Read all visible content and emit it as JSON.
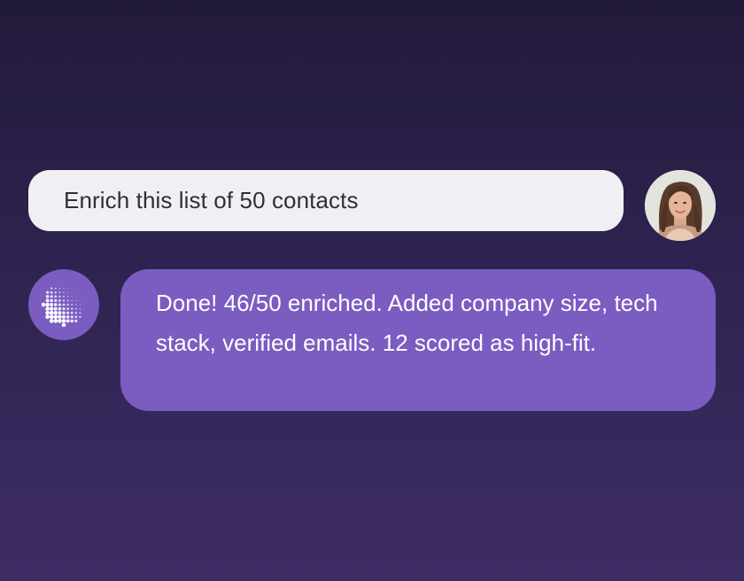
{
  "user_message": {
    "text": "Enrich this list of 50 contacts",
    "avatar_icon": "user-photo-avatar"
  },
  "assistant_message": {
    "text": "Done! 46/50 enriched. Added company size, tech stack, verified emails. 12 scored as high-fit.",
    "avatar_icon": "dotted-sphere-logo-icon"
  },
  "colors": {
    "background_top": "#221a3a",
    "background_bottom": "#3e2d64",
    "user_bubble": "#f0f0f4",
    "assistant_bubble": "#7b5cc1",
    "user_text": "#2f2f37",
    "assistant_text": "#ffffff"
  }
}
